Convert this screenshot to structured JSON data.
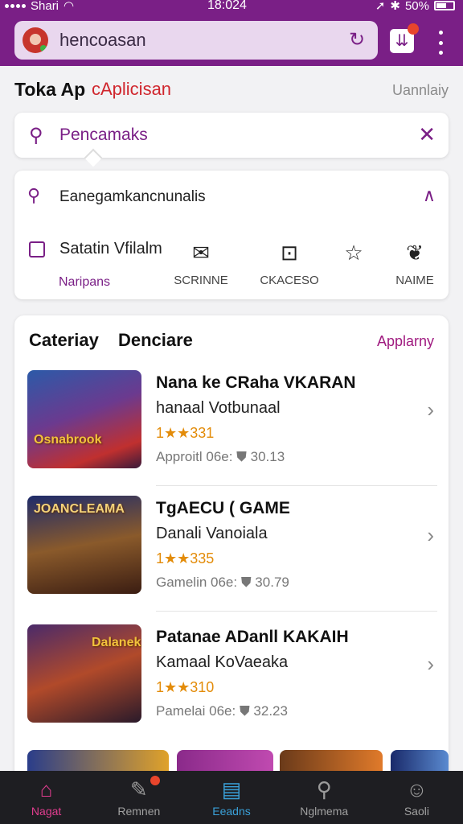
{
  "status": {
    "carrier": "Shari",
    "time": "18:024",
    "battery": "50%"
  },
  "header": {
    "search_text": "hencoasan"
  },
  "title_row": {
    "title": "Toka Ap",
    "highlight": "cAplicisan",
    "right": "Uannlaiy"
  },
  "search": {
    "text": "Pencamaks"
  },
  "filter": {
    "search_text": "Eanegamkancnunalis",
    "checkbox_label": "Satatin Vfilalm",
    "nav_label": "Naripans",
    "options": [
      {
        "label": "SCRINNE",
        "icon": "ticket-icon"
      },
      {
        "label": "CKACESO",
        "icon": "image-icon"
      },
      {
        "label": "NAIME",
        "icon": "star-icon"
      },
      {
        "label": "",
        "icon": "controller-icon"
      }
    ]
  },
  "list": {
    "head_left": "Cateriay",
    "head_mid": "Denciare",
    "link": "Applarny",
    "items": [
      {
        "title": "Nana ke CRaha VKARAN",
        "subtitle": "hanaal Votbunaal",
        "rating": "1★★331",
        "meta": "Approitl 06e:  ⛊ 30.13",
        "thumb_text": "Osnabrook"
      },
      {
        "title": "TgAECU ( GAME",
        "subtitle": "Danali Vanoiala",
        "rating": "1★★335",
        "meta": "Gamelin 06e:  ⛊ 30.79",
        "thumb_text": "JOANCLEAMA"
      },
      {
        "title": "Patanae ADanll KAKAIH",
        "subtitle": "Kamaal KoVaeaka",
        "rating": "1★★310",
        "meta": "Pamelai 06e:  ⛊ 32.23",
        "thumb_text": "Dalanek"
      }
    ]
  },
  "bottom_nav": [
    {
      "label": "Nagat",
      "icon": "home-icon"
    },
    {
      "label": "Remnen",
      "icon": "edit-icon"
    },
    {
      "label": "Eeadns",
      "icon": "inbox-icon"
    },
    {
      "label": "Nglmema",
      "icon": "search-icon"
    },
    {
      "label": "Saoli",
      "icon": "profile-icon"
    }
  ],
  "colors": {
    "brand": "#7a1f86",
    "accent": "#e03d8f",
    "rating": "#e38c0a"
  }
}
